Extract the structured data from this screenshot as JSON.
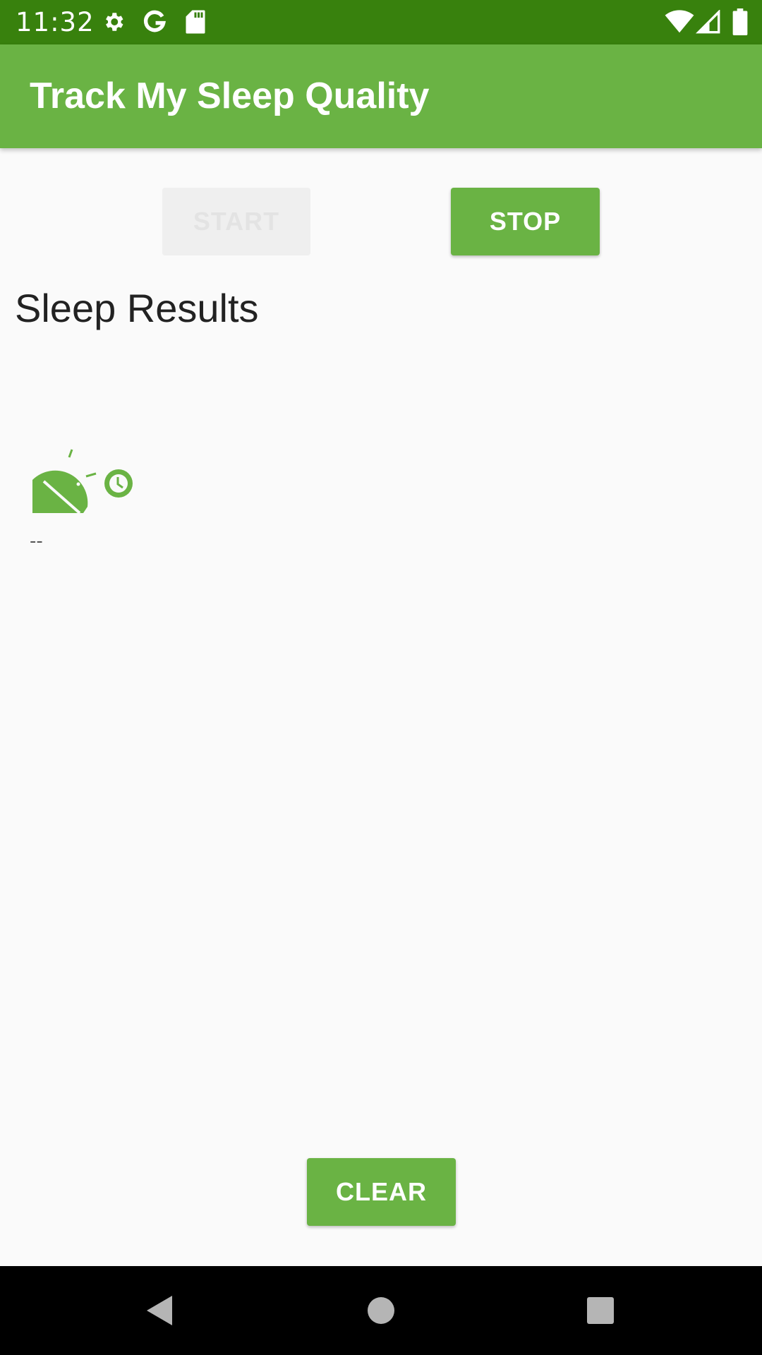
{
  "status_bar": {
    "time": "11:32",
    "icons": [
      "gear-icon",
      "google-g-icon",
      "sd-card-icon",
      "wifi-icon",
      "signal-icon",
      "battery-icon"
    ]
  },
  "app_bar": {
    "title": "Track My Sleep Quality"
  },
  "buttons": {
    "start_label": "Start",
    "stop_label": "Stop",
    "clear_label": "Clear"
  },
  "results": {
    "title": "Sleep Results",
    "items": [
      {
        "icon": "sleep-quality-icon",
        "duration": "--"
      }
    ]
  },
  "nav_bar": {
    "icons": [
      "back-icon",
      "home-icon",
      "recents-icon"
    ]
  },
  "colors": {
    "status_bar": "#38810d",
    "primary": "#6ab344",
    "background": "#fafafa",
    "disabled_button": "#efefef"
  }
}
